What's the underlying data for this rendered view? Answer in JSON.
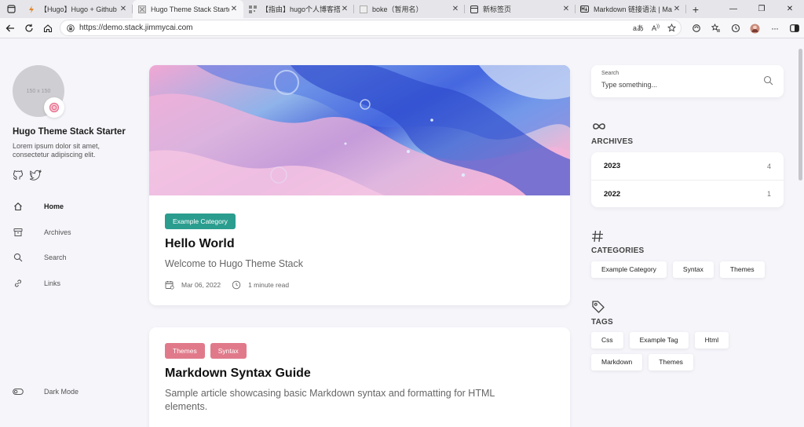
{
  "browser": {
    "tabs": [
      {
        "title": "【Hugo】Hugo + Github 免费部署自己的博客",
        "active": false
      },
      {
        "title": "Hugo Theme Stack Starter",
        "active": true
      },
      {
        "title": "【指由】hugo个人博客搭建",
        "active": false
      },
      {
        "title": "boke（暂用名）",
        "active": false
      },
      {
        "title": "新标签页",
        "active": false
      },
      {
        "title": "Markdown 链接语法 | Markdown",
        "active": false
      }
    ],
    "url": "https://demo.stack.jimmycai.com"
  },
  "sidebar": {
    "avatar_placeholder": "150 x 150",
    "site_title": "Hugo Theme Stack Starter",
    "site_desc": "Lorem ipsum dolor sit amet, consectetur adipiscing elit.",
    "menu": [
      {
        "label": "Home",
        "icon": "home-icon"
      },
      {
        "label": "Archives",
        "icon": "archive-icon"
      },
      {
        "label": "Search",
        "icon": "search-icon"
      },
      {
        "label": "Links",
        "icon": "link-icon"
      }
    ],
    "dark_mode": "Dark Mode"
  },
  "articles": [
    {
      "categories": [
        {
          "label": "Example Category",
          "color": "#2a9d8f"
        }
      ],
      "title": "Hello World",
      "subtitle": "Welcome to Hugo Theme Stack",
      "date": "Mar 06, 2022",
      "read_time": "1 minute read"
    },
    {
      "categories": [
        {
          "label": "Themes",
          "color": "#e07a8a"
        },
        {
          "label": "Syntax",
          "color": "#e07a8a"
        }
      ],
      "title": "Markdown Syntax Guide",
      "subtitle": "Sample article showcasing basic Markdown syntax and formatting for HTML elements."
    }
  ],
  "widgets": {
    "search": {
      "label": "Search",
      "placeholder": "Type something..."
    },
    "archives": {
      "heading": "ARCHIVES",
      "rows": [
        {
          "year": "2023",
          "count": "4"
        },
        {
          "year": "2022",
          "count": "1"
        }
      ]
    },
    "categories": {
      "heading": "CATEGORIES",
      "items": [
        "Example Category",
        "Syntax",
        "Themes"
      ]
    },
    "tags": {
      "heading": "TAGS",
      "items": [
        "Css",
        "Example Tag",
        "Html",
        "Markdown",
        "Themes"
      ]
    }
  }
}
